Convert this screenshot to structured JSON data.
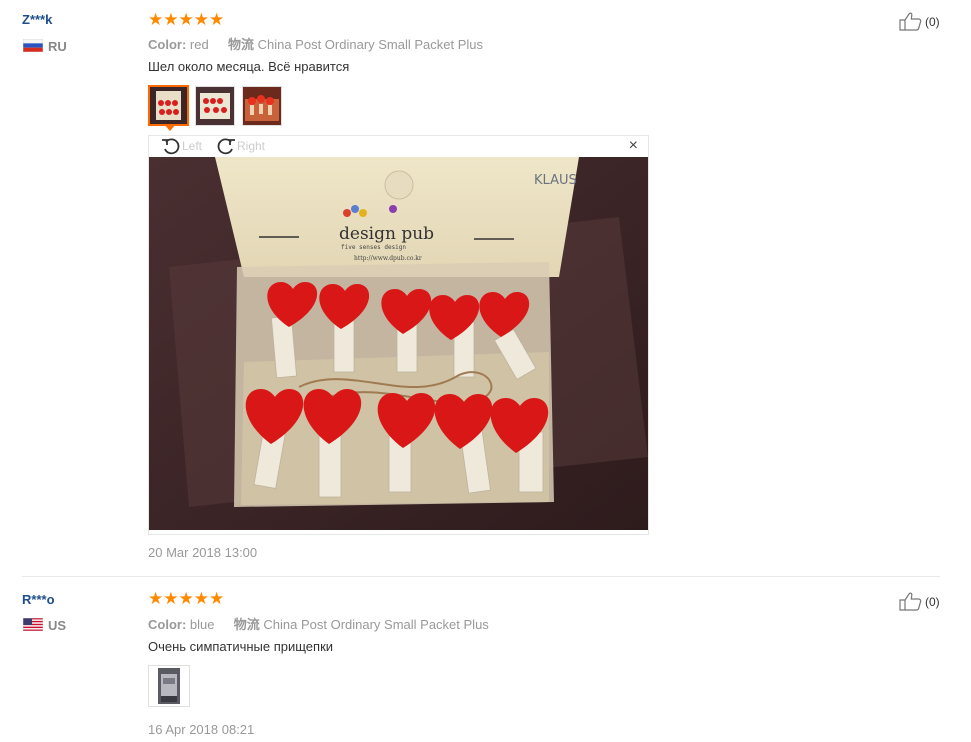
{
  "reviews": [
    {
      "user": "Z***k",
      "country": "RU",
      "stars": "★★★★★",
      "color_label": "Color:",
      "color_value": "red",
      "shipping_label": "物流",
      "shipping_value": "China Post Ordinary Small Packet Plus",
      "text": "Шел около месяца. Всё нравится",
      "helpful_count": "(0)",
      "date": "20 Mar 2018 13:00",
      "viewer": {
        "rotate_left": "Left",
        "rotate_right": "Right",
        "close": "×",
        "photo_brand": "KLAUS",
        "photo_logo": "design pub",
        "photo_tagline": "five senses design",
        "photo_url": "http://www.dpub.co.kr"
      }
    },
    {
      "user": "R***o",
      "country": "US",
      "stars": "★★★★★",
      "color_label": "Color:",
      "color_value": "blue",
      "shipping_label": "物流",
      "shipping_value": "China Post Ordinary Small Packet Plus",
      "text": "Очень симпатичные прищепки",
      "helpful_count": "(0)",
      "date": "16 Apr 2018 08:21"
    }
  ],
  "colors": {
    "star": "#ff8a00",
    "accent": "#ff6a00",
    "username": "#1f4e8c"
  }
}
